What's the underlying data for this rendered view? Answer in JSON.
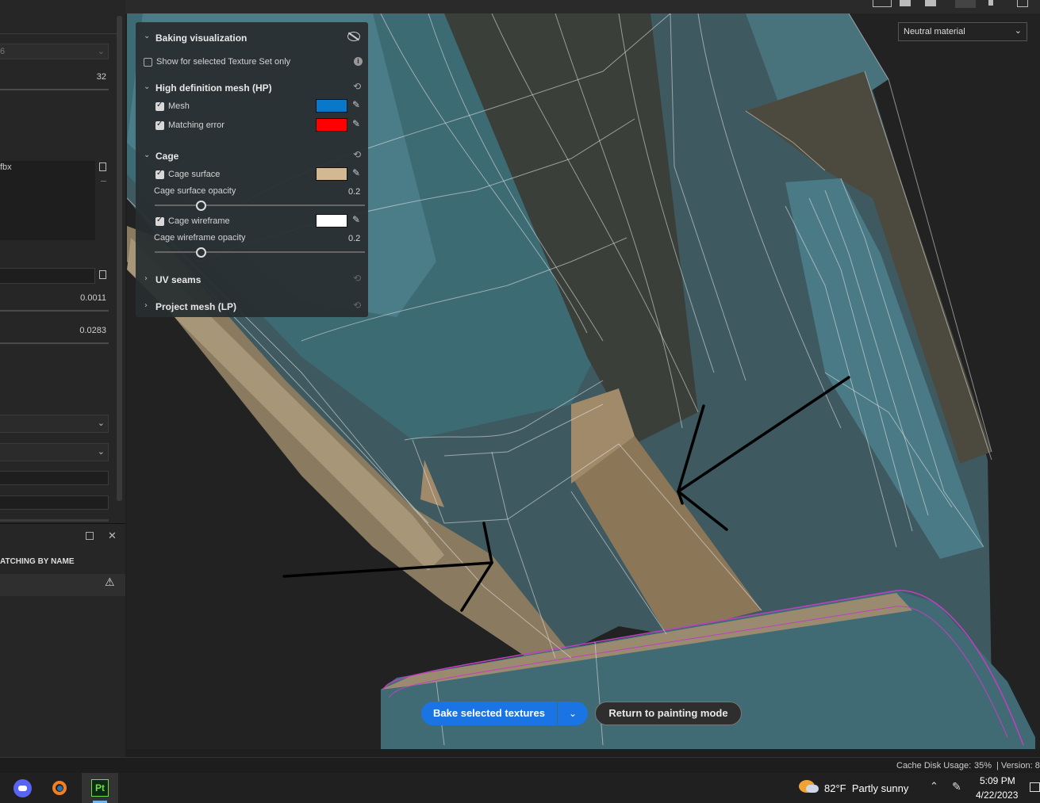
{
  "left_panel": {
    "dropdown_partial": "6",
    "value_32": "32",
    "file_partial": "fbx",
    "value_0011": "0.0011",
    "value_0283": "0.0283",
    "match_label": "ATCHING BY NAME"
  },
  "baking_viz": {
    "title": "Baking visualization",
    "show_selected": "Show for selected Texture Set only",
    "hp_title": "High definition mesh (HP)",
    "mesh_label": "Mesh",
    "mesh_color": "#0a78c8",
    "matching_label": "Matching error",
    "matching_color": "#ff0000",
    "cage_title": "Cage",
    "cage_surface_label": "Cage surface",
    "cage_surface_color": "#d2b992",
    "cage_surface_opacity_label": "Cage surface opacity",
    "cage_surface_opacity": "0.2",
    "cage_wire_label": "Cage wireframe",
    "cage_wire_color": "#ffffff",
    "cage_wire_opacity_label": "Cage wireframe opacity",
    "cage_wire_opacity": "0.2",
    "uv_title": "UV seams",
    "project_title": "Project mesh (LP)"
  },
  "material_dropdown": "Neutral material",
  "bake_button": "Bake selected textures",
  "return_button": "Return to painting mode",
  "status": {
    "cache": "Cache Disk Usage:",
    "percent": "35%",
    "version": "| Version: 8"
  },
  "taskbar": {
    "weather": "82°F  Partly sunny",
    "time": "5:09 PM",
    "date": "4/22/2023",
    "pt_label": "Pt"
  }
}
